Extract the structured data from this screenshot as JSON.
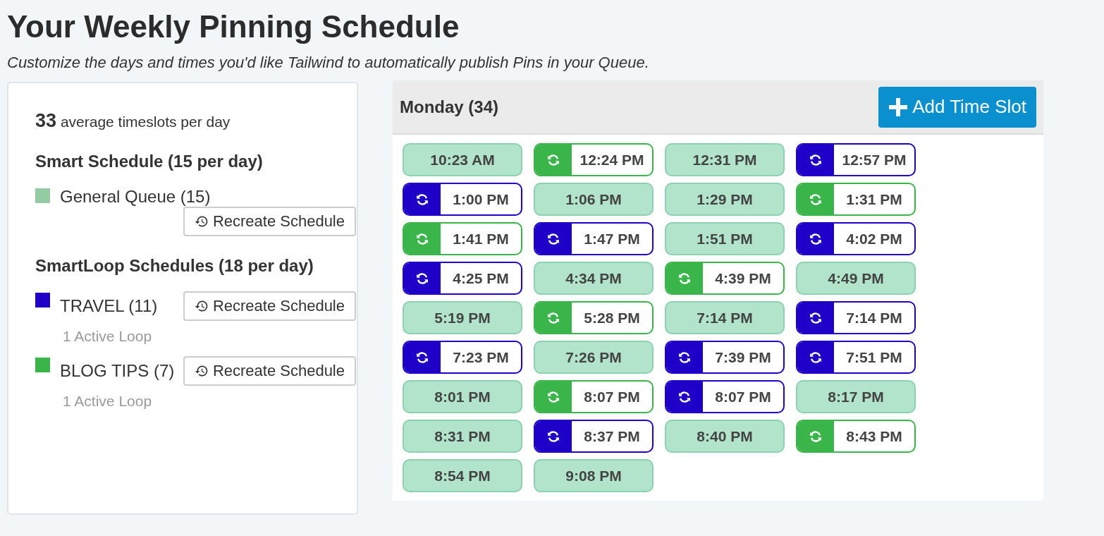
{
  "title": "Your Weekly Pinning Schedule",
  "subtitle": "Customize the days and times you'd like Tailwind to automatically publish Pins in your Queue.",
  "summary": {
    "count": "33",
    "label": "average timeslots per day"
  },
  "sections": [
    {
      "heading": "Smart Schedule (15 per day)",
      "items": [
        {
          "name": "General Queue (15)",
          "color": "#93cca3",
          "button": "Recreate Schedule"
        }
      ]
    },
    {
      "heading": "SmartLoop Schedules (18 per day)",
      "items": [
        {
          "name": "TRAVEL (11)",
          "color": "#1e00c8",
          "button": "Recreate Schedule",
          "note": "1 Active Loop"
        },
        {
          "name": "BLOG TIPS (7)",
          "color": "#3ab54a",
          "button": "Recreate Schedule",
          "note": "1 Active Loop"
        }
      ]
    }
  ],
  "day": {
    "title": "Monday (34)",
    "add_button": "Add Time Slot"
  },
  "slots": [
    {
      "time": "10:23 AM",
      "kind": "smart"
    },
    {
      "time": "12:24 PM",
      "kind": "loop",
      "color": "#3ab54a"
    },
    {
      "time": "12:31 PM",
      "kind": "smart"
    },
    {
      "time": "12:57 PM",
      "kind": "loop",
      "color": "#1e00c8"
    },
    {
      "time": "1:00 PM",
      "kind": "loop",
      "color": "#1e00c8"
    },
    {
      "time": "1:06 PM",
      "kind": "smart"
    },
    {
      "time": "1:29 PM",
      "kind": "smart"
    },
    {
      "time": "1:31 PM",
      "kind": "loop",
      "color": "#3ab54a"
    },
    {
      "time": "1:41 PM",
      "kind": "loop",
      "color": "#3ab54a"
    },
    {
      "time": "1:47 PM",
      "kind": "loop",
      "color": "#1e00c8"
    },
    {
      "time": "1:51 PM",
      "kind": "smart"
    },
    {
      "time": "4:02 PM",
      "kind": "loop",
      "color": "#1e00c8"
    },
    {
      "time": "4:25 PM",
      "kind": "loop",
      "color": "#1e00c8"
    },
    {
      "time": "4:34 PM",
      "kind": "smart"
    },
    {
      "time": "4:39 PM",
      "kind": "loop",
      "color": "#3ab54a"
    },
    {
      "time": "4:49 PM",
      "kind": "smart"
    },
    {
      "time": "5:19 PM",
      "kind": "smart"
    },
    {
      "time": "5:28 PM",
      "kind": "loop",
      "color": "#3ab54a"
    },
    {
      "time": "7:14 PM",
      "kind": "smart"
    },
    {
      "time": "7:14 PM",
      "kind": "loop",
      "color": "#1e00c8"
    },
    {
      "time": "7:23 PM",
      "kind": "loop",
      "color": "#1e00c8"
    },
    {
      "time": "7:26 PM",
      "kind": "smart"
    },
    {
      "time": "7:39 PM",
      "kind": "loop",
      "color": "#1e00c8"
    },
    {
      "time": "7:51 PM",
      "kind": "loop",
      "color": "#1e00c8"
    },
    {
      "time": "8:01 PM",
      "kind": "smart"
    },
    {
      "time": "8:07 PM",
      "kind": "loop",
      "color": "#3ab54a"
    },
    {
      "time": "8:07 PM",
      "kind": "loop",
      "color": "#1e00c8"
    },
    {
      "time": "8:17 PM",
      "kind": "smart"
    },
    {
      "time": "8:31 PM",
      "kind": "smart"
    },
    {
      "time": "8:37 PM",
      "kind": "loop",
      "color": "#1e00c8"
    },
    {
      "time": "8:40 PM",
      "kind": "smart"
    },
    {
      "time": "8:43 PM",
      "kind": "loop",
      "color": "#3ab54a"
    },
    {
      "time": "8:54 PM",
      "kind": "smart"
    },
    {
      "time": "9:08 PM",
      "kind": "smart"
    }
  ]
}
